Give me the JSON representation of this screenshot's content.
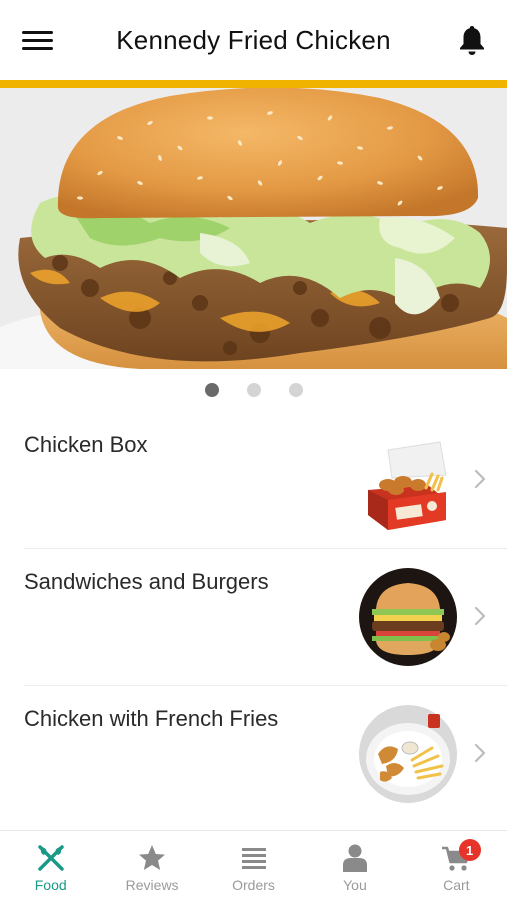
{
  "header": {
    "title": "Kennedy Fried Chicken",
    "menu_icon": "hamburger-menu-icon",
    "bell_icon": "bell-icon",
    "accent_color": "#f0b400"
  },
  "banner": {
    "image": "burger-photo",
    "slides": 3,
    "active_slide": 1
  },
  "categories": [
    {
      "label": "Chicken Box",
      "image": "chicken-box-photo"
    },
    {
      "label": "Sandwiches and Burgers",
      "image": "burger-photo"
    },
    {
      "label": "Chicken with French Fries",
      "image": "chicken-fries-plate-photo"
    }
  ],
  "tabbar": {
    "active_color": "#1a9a86",
    "inactive_color": "#9a9a9a",
    "tabs": [
      {
        "label": "Food",
        "icon": "fork-knife-icon",
        "active": true
      },
      {
        "label": "Reviews",
        "icon": "star-icon",
        "active": false
      },
      {
        "label": "Orders",
        "icon": "list-icon",
        "active": false
      },
      {
        "label": "You",
        "icon": "person-icon",
        "active": false
      },
      {
        "label": "Cart",
        "icon": "cart-icon",
        "active": false,
        "badge": "1"
      }
    ]
  }
}
